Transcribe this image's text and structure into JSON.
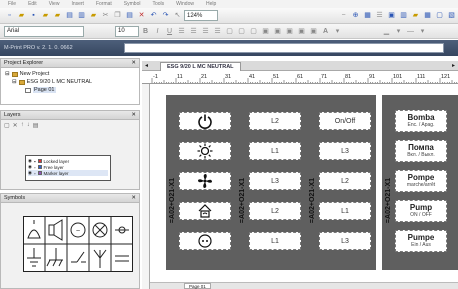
{
  "menubar": {
    "items": [
      "File",
      "Edit",
      "View",
      "Insert",
      "Format",
      "Symbol",
      "Tools",
      "Window",
      "Help"
    ]
  },
  "toolbar1": {
    "zoom": "124%"
  },
  "toolbar2": {
    "font": "Arial",
    "font_size": "10"
  },
  "titlebar": {
    "title": "M-Print PRO v. 2. 1. 0. 0662"
  },
  "project_explorer": {
    "title": "Project Explorer",
    "items": [
      {
        "label": "New Project"
      },
      {
        "label": "ESG 9/20 L MC NEUTRAL"
      },
      {
        "label": "Page 01"
      }
    ]
  },
  "layers": {
    "title": "Layers",
    "rows": [
      {
        "label": "Locked layer",
        "color": "#e03030"
      },
      {
        "label": "Free layer",
        "color": "#3060d0"
      },
      {
        "label": "Marker layer",
        "color": "#9050c0"
      }
    ]
  },
  "symbols": {
    "title": "Symbols"
  },
  "document_tab": {
    "label": "ESG 9/20 L MC NEUTRAL"
  },
  "canvas": {
    "strip_label": "=A02+O21-X1",
    "strips": [
      {
        "cells": [
          {
            "icon": "power-icon"
          },
          {
            "icon": "light-icon"
          },
          {
            "icon": "fan-icon"
          },
          {
            "icon": "house-icon"
          },
          {
            "icon": "plug-icon"
          }
        ]
      },
      {
        "cells": [
          {
            "text": "L2"
          },
          {
            "text": "L1"
          },
          {
            "text": "L3"
          },
          {
            "text": "L2"
          },
          {
            "text": "L1"
          }
        ]
      },
      {
        "cells": [
          {
            "text": "On/Off"
          },
          {
            "text": "L3"
          },
          {
            "text": "L2"
          },
          {
            "text": "L1"
          },
          {
            "text": "L3"
          }
        ]
      },
      {
        "cells": [
          {
            "title": "Bomba",
            "sub": "Enc. / Apag."
          },
          {
            "title": "Помпа",
            "sub": "Вкл. / Выкл."
          },
          {
            "title": "Pompe",
            "sub": "marche/arrêt"
          },
          {
            "title": "Pump",
            "sub": "ON / OFF"
          },
          {
            "title": "Pumpe",
            "sub": "Ein / Aus"
          }
        ]
      }
    ]
  },
  "bottom_tab": {
    "label": "Page 01"
  },
  "ruler": {
    "labels": [
      "-1",
      "11",
      "21",
      "31",
      "41",
      "51",
      "61",
      "71",
      "81",
      "91",
      "101",
      "111",
      "121"
    ]
  }
}
